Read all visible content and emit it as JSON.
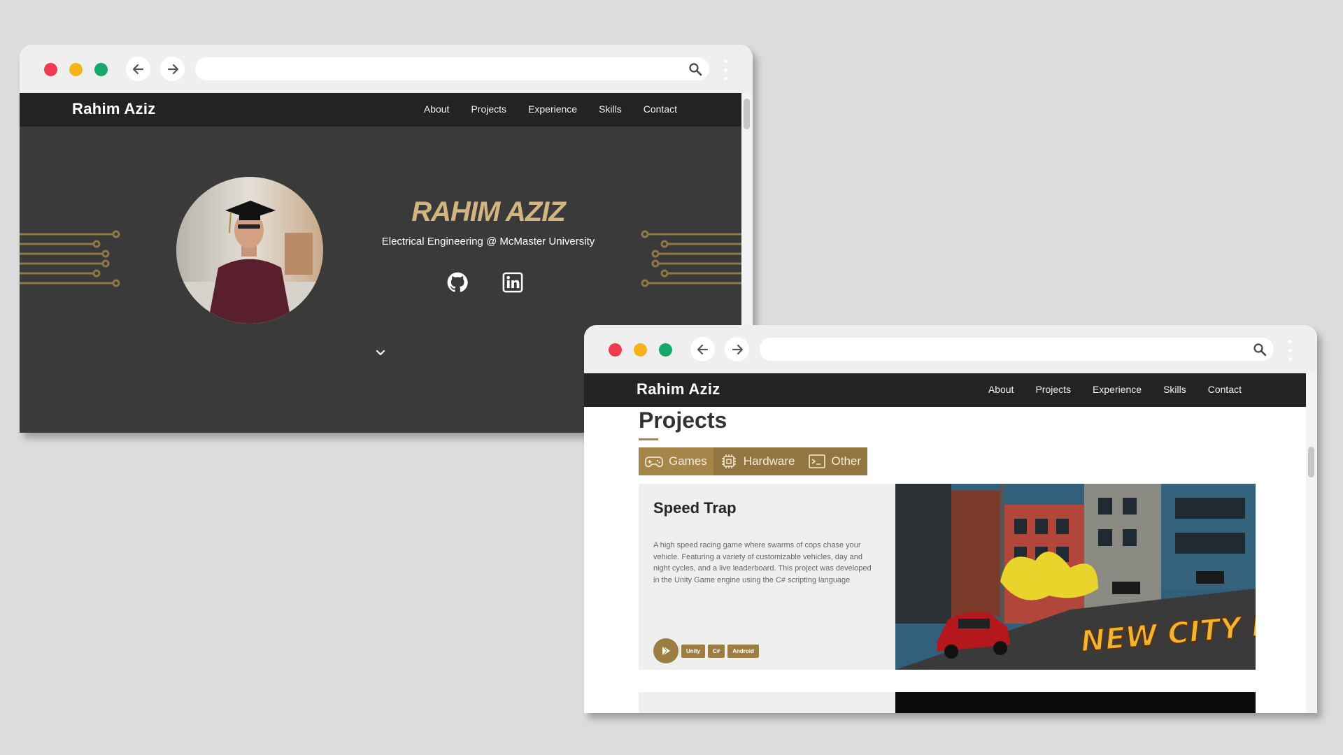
{
  "site": {
    "brand": "Rahim Aziz",
    "menu": [
      "About",
      "Projects",
      "Experience",
      "Skills",
      "Contact"
    ]
  },
  "hero": {
    "name": "RAHIM AZIZ",
    "tagline": "Electrical Engineering @ McMaster University",
    "social_icons": [
      "github-icon",
      "linkedin-icon"
    ]
  },
  "projects": {
    "heading": "Projects",
    "tabs": [
      {
        "label": "Games",
        "icon": "gamepad-icon",
        "active": true
      },
      {
        "label": "Hardware",
        "icon": "chip-icon",
        "active": false
      },
      {
        "label": "Other",
        "icon": "terminal-icon",
        "active": false
      }
    ],
    "card": {
      "title": "Speed Trap",
      "description": "A high speed racing game where swarms of cops chase your vehicle. Featuring a variety of customizable vehicles, day and night cycles, and a live leaderboard. This project was developed in the Unity Game engine using the C# scripting language",
      "tags": [
        "Unity",
        "C#",
        "Android"
      ],
      "image_banner": "NEW CITY MAP"
    }
  },
  "colors": {
    "accent": "#a58548",
    "dark": "#232323",
    "hero_bg": "#3a3a3a",
    "name_gold": "#d2b57f"
  }
}
